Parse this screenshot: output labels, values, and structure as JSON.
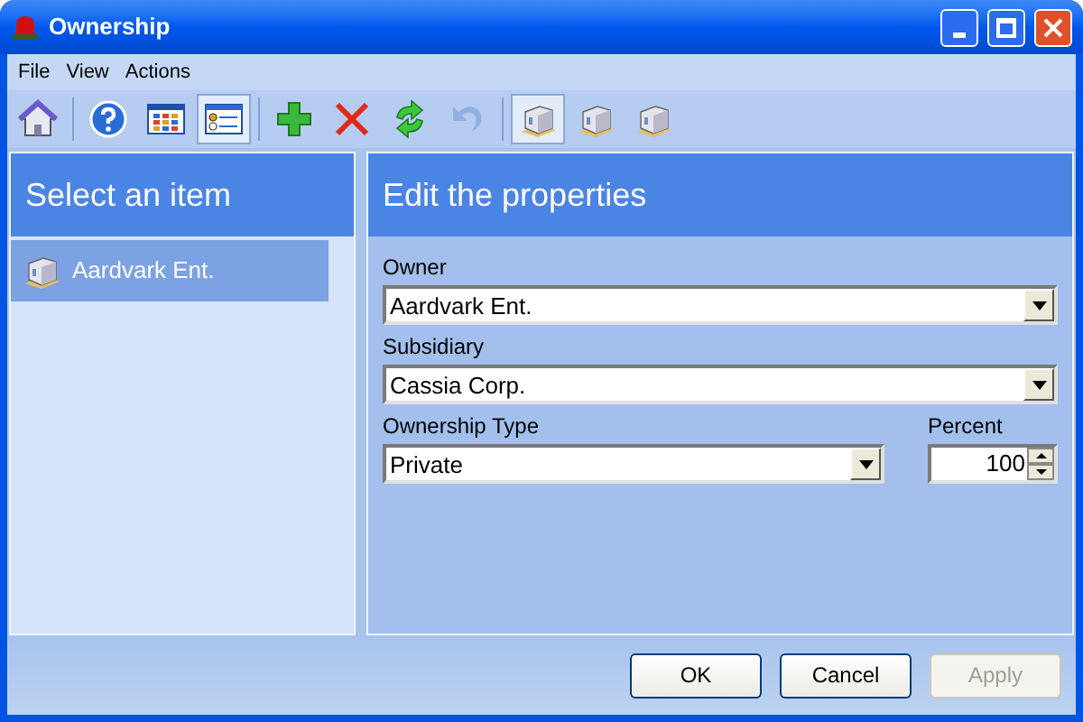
{
  "window": {
    "title": "Ownership"
  },
  "menu": [
    "File",
    "View",
    "Actions"
  ],
  "toolbar": [
    {
      "buttons": [
        {
          "kind": "home",
          "selected": false,
          "disabled": false
        }
      ]
    },
    {
      "buttons": [
        {
          "kind": "help",
          "selected": false,
          "disabled": false
        },
        {
          "kind": "grid",
          "selected": false,
          "disabled": false
        },
        {
          "kind": "form",
          "selected": true,
          "disabled": false
        }
      ]
    },
    {
      "buttons": [
        {
          "kind": "add",
          "selected": false,
          "disabled": false
        },
        {
          "kind": "delete",
          "selected": false,
          "disabled": false
        },
        {
          "kind": "refresh",
          "selected": false,
          "disabled": false
        },
        {
          "kind": "undo",
          "selected": false,
          "disabled": true
        }
      ]
    },
    {
      "buttons": [
        {
          "kind": "building",
          "selected": true,
          "disabled": false
        },
        {
          "kind": "building",
          "selected": false,
          "disabled": false
        },
        {
          "kind": "building",
          "selected": false,
          "disabled": false
        }
      ]
    }
  ],
  "list_panel": {
    "heading": "Select an item",
    "items": [
      {
        "label": "Aardvark Ent.",
        "selected": true
      }
    ]
  },
  "edit_panel": {
    "heading": "Edit the properties",
    "owner": {
      "label": "Owner",
      "value": "Aardvark Ent."
    },
    "subsidiary": {
      "label": "Subsidiary",
      "value": "Cassia Corp."
    },
    "ownership_type": {
      "label": "Ownership Type",
      "value": "Private"
    },
    "percent": {
      "label": "Percent",
      "value": "100"
    }
  },
  "buttons": [
    {
      "label": "OK",
      "disabled": false
    },
    {
      "label": "Cancel",
      "disabled": false
    },
    {
      "label": "Apply",
      "disabled": true
    }
  ]
}
